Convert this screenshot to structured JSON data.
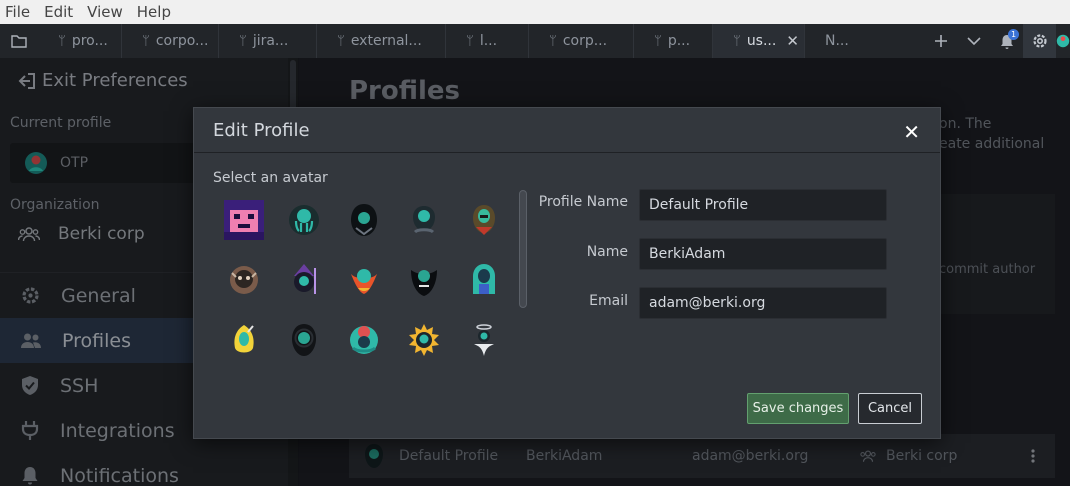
{
  "menu": [
    "File",
    "Edit",
    "View",
    "Help"
  ],
  "tabs": [
    {
      "label": "pro..."
    },
    {
      "label": "corpo..."
    },
    {
      "label": "jira..."
    },
    {
      "label": "external..."
    },
    {
      "label": "l..."
    },
    {
      "label": "corp..."
    },
    {
      "label": "p..."
    },
    {
      "label": "us...",
      "active": true,
      "close": "✕"
    },
    {
      "label": "N..."
    }
  ],
  "notification_count": "1",
  "sidebar": {
    "exit_label": "Exit Preferences",
    "current_profile_label": "Current profile",
    "current_profile_name": "OTP",
    "organization_label": "Organization",
    "organization_name": "Berki corp",
    "nav": [
      {
        "label": "General",
        "icon": "gear-icon"
      },
      {
        "label": "Profiles",
        "icon": "users-icon",
        "active": true
      },
      {
        "label": "SSH",
        "icon": "shield-icon"
      },
      {
        "label": "Integrations",
        "icon": "plug-icon"
      },
      {
        "label": "Notifications",
        "icon": "bell-icon"
      }
    ]
  },
  "main": {
    "title": "Profiles",
    "desc_line1": "on. The",
    "desc_line2": "eate additional",
    "card_text": "commit author",
    "row": {
      "profile": "Default Profile",
      "name": "BerkiAdam",
      "email": "adam@berki.org",
      "org": "Berki corp"
    }
  },
  "modal": {
    "title": "Edit Profile",
    "close": "✕",
    "avatar_label": "Select an avatar",
    "avatars": [
      "pixel-avatar",
      "octopus-avatar",
      "hooded-avatar",
      "alien-avatar",
      "warrior-avatar",
      "monkey-avatar",
      "wizard-avatar",
      "fire-bird-avatar",
      "dark-knight-avatar",
      "pharaoh-avatar",
      "banana-avatar",
      "reaper-avatar",
      "medusa-avatar",
      "sun-avatar",
      "angel-avatar"
    ],
    "fields": {
      "profile_name_label": "Profile Name",
      "profile_name_value": "Default Profile",
      "name_label": "Name",
      "name_value": "BerkiAdam",
      "email_label": "Email",
      "email_value": "adam@berki.org"
    },
    "save_label": "Save changes",
    "cancel_label": "Cancel"
  },
  "colors": {
    "accent_green": "#3e6b48",
    "active_nav": "#2e3d52",
    "teal_avatar": "#2fb9a8"
  }
}
